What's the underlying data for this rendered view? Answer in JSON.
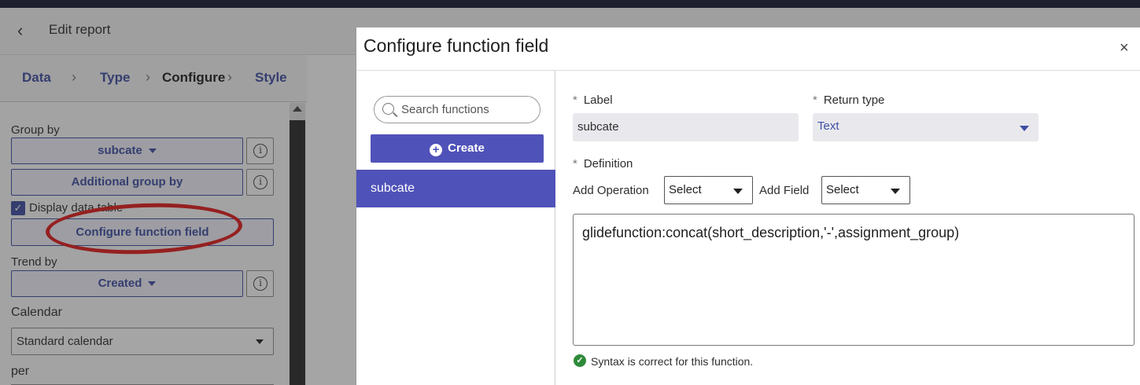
{
  "background": {
    "header": {
      "title": "Edit report"
    },
    "breadcrumbs": [
      "Data",
      "Type",
      "Configure",
      "Style"
    ],
    "active_breadcrumb": "Configure",
    "group_by": {
      "label": "Group by",
      "value": "subcate",
      "additional": "Additional group by"
    },
    "display_data_table": {
      "label": "Display data table",
      "checked": true
    },
    "configure_function_field": "Configure function field",
    "trend_by": {
      "label": "Trend by",
      "value": "Created"
    },
    "calendar": {
      "label": "Calendar",
      "value": "Standard calendar"
    },
    "per": {
      "label": "per"
    },
    "annotation_color": "#e41b1b"
  },
  "modal": {
    "title": "Configure function field",
    "close_symbol": "×",
    "search": {
      "placeholder": "Search functions"
    },
    "create_label": "Create",
    "functions": [
      "subcate"
    ],
    "label_field": {
      "label": "Label",
      "value": "subcate"
    },
    "return_type": {
      "label": "Return type",
      "value": "Text"
    },
    "definition": {
      "label": "Definition",
      "add_operation_label": "Add Operation",
      "add_operation_value": "Select",
      "add_field_label": "Add Field",
      "add_field_value": "Select",
      "text": "glidefunction:concat(short_description,'-',assignment_group)"
    },
    "syntax_message": "Syntax is correct for this function.",
    "required_marker": "*"
  },
  "colors": {
    "accent": "#4f52b8",
    "link": "#3f4ea3",
    "success": "#2e8b3a"
  }
}
